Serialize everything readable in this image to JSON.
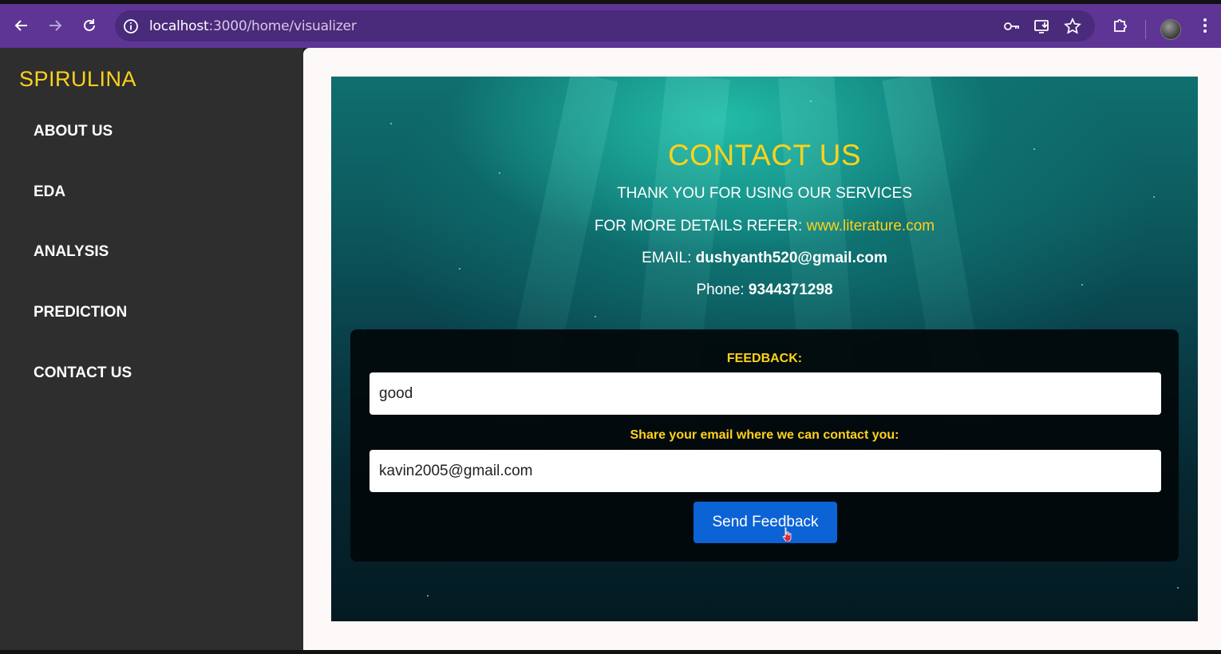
{
  "browser": {
    "url_host": "localhost",
    "url_path": ":3000/home/visualizer",
    "icons": [
      "back-arrow-icon",
      "forward-arrow-icon",
      "reload-icon",
      "site-info-icon",
      "password-key-icon",
      "install-app-icon",
      "bookmark-star-icon",
      "extensions-puzzle-icon",
      "profile-avatar",
      "menu-dots-icon"
    ],
    "theme_color": "#5e3595"
  },
  "sidebar": {
    "brand": "SPIRULINA",
    "brand_color": "#ffd21a",
    "items": [
      {
        "label": "ABOUT US"
      },
      {
        "label": "EDA"
      },
      {
        "label": "ANALYSIS"
      },
      {
        "label": "PREDICTION"
      },
      {
        "label": "CONTACT US"
      }
    ]
  },
  "contact": {
    "title": "CONTACT US",
    "thanks": "THANK YOU FOR USING OUR SERVICES",
    "details_prefix": "FOR MORE DETAILS REFER:",
    "details_link": "www.literature.com",
    "email_prefix": "EMAIL:",
    "email_value": "dushyanth520@gmail.com",
    "phone_prefix": "Phone:",
    "phone_value": "9344371298"
  },
  "form": {
    "feedback_label": "FEEDBACK:",
    "feedback_value": "good",
    "email_label": "Share your email where we can contact you:",
    "email_value": "kavin2005@gmail.com",
    "submit_label": "Send Feedback",
    "submit_color": "#0b63d6"
  }
}
